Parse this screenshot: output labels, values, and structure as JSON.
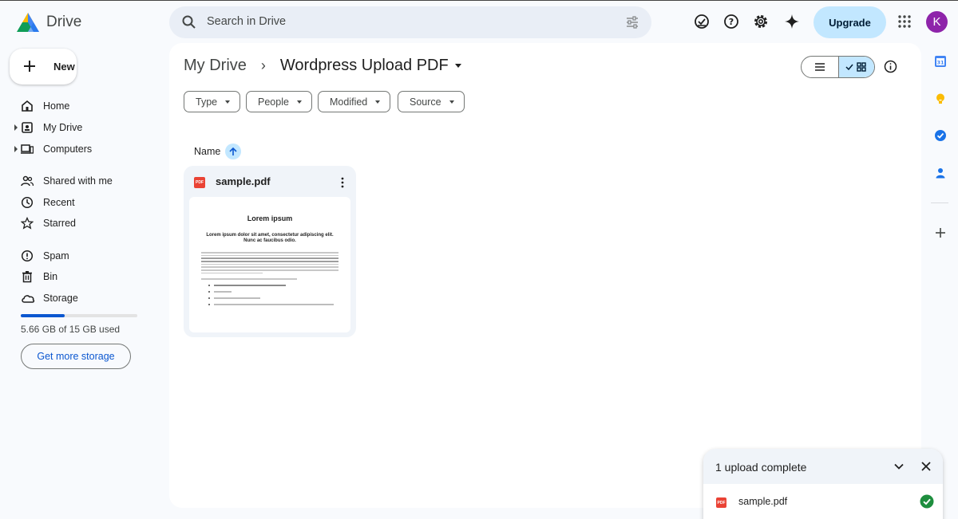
{
  "app": {
    "brand": "Drive"
  },
  "search": {
    "placeholder": "Search in Drive"
  },
  "header": {
    "upgrade_label": "Upgrade",
    "avatar_initial": "K",
    "icons": [
      "ready-offline-icon",
      "help-icon",
      "settings-icon",
      "gemini-sparkle-icon",
      "apps-grid-icon"
    ]
  },
  "sidebar": {
    "new_label": "New",
    "items": [
      {
        "label": "Home",
        "icon": "home-icon",
        "expandable": false
      },
      {
        "label": "My Drive",
        "icon": "my-drive-icon",
        "expandable": true
      },
      {
        "label": "Computers",
        "icon": "computers-icon",
        "expandable": true
      },
      {
        "label": "Shared with me",
        "icon": "shared-icon",
        "expandable": false
      },
      {
        "label": "Recent",
        "icon": "clock-icon",
        "expandable": false
      },
      {
        "label": "Starred",
        "icon": "star-icon",
        "expandable": false
      },
      {
        "label": "Spam",
        "icon": "spam-icon",
        "expandable": false
      },
      {
        "label": "Bin",
        "icon": "trash-icon",
        "expandable": false
      },
      {
        "label": "Storage",
        "icon": "cloud-icon",
        "expandable": false
      }
    ],
    "storage_text": "5.66 GB of 15 GB used",
    "storage_fraction": 0.377,
    "get_storage_label": "Get more storage"
  },
  "breadcrumb": {
    "root": "My Drive",
    "current": "Wordpress Upload PDF"
  },
  "filters": [
    "Type",
    "People",
    "Modified",
    "Source"
  ],
  "list": {
    "name_header": "Name"
  },
  "files": [
    {
      "name": "sample.pdf",
      "type_badge": "PDF",
      "preview": {
        "title": "Lorem ipsum",
        "subtitle": "Lorem ipsum dolor sit amet, consectetur adipiscing elit. Nunc ac faucibus odio."
      }
    }
  ],
  "right_panel": {
    "icons": [
      "calendar-icon",
      "keep-icon",
      "tasks-icon",
      "contacts-icon",
      "add-icon"
    ]
  },
  "upload_panel": {
    "title": "1 upload complete",
    "items": [
      {
        "name": "sample.pdf",
        "type_badge": "PDF",
        "status": "complete"
      }
    ]
  },
  "colors": {
    "accent": "#0b57d0",
    "selected": "#c2e7ff",
    "pdf": "#ea4335",
    "success": "#1e8e3e",
    "avatar": "#8e24aa"
  }
}
